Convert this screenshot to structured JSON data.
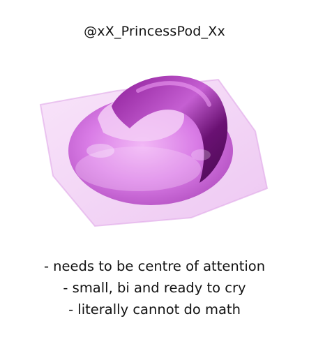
{
  "handle": "@xX_PrincessPod_Xx",
  "image": {
    "subject": "detergent-pod-icon",
    "colors": {
      "film": "#f0c8f4",
      "pod_body": "#d97ce6",
      "swirl_dark": "#6a1173",
      "swirl_mid": "#a42ab0"
    }
  },
  "lines": [
    "- needs to be centre of attention",
    "- small, bi and ready to cry",
    "- literally cannot do math"
  ]
}
